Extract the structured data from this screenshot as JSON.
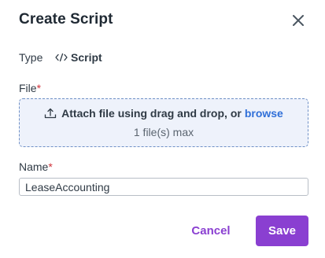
{
  "dialog": {
    "title": "Create Script",
    "close_icon": "close-icon"
  },
  "type": {
    "label": "Type",
    "value": "Script",
    "icon": "code-icon"
  },
  "file": {
    "label": "File",
    "required_marker": "*",
    "dropzone": {
      "icon": "upload-icon",
      "text": "Attach file using drag and drop, or",
      "browse_label": "browse",
      "max_text": "1 file(s) max"
    }
  },
  "name": {
    "label": "Name",
    "required_marker": "*",
    "value": "LeaseAccounting"
  },
  "actions": {
    "cancel_label": "Cancel",
    "save_label": "Save"
  },
  "colors": {
    "accent": "#8a3fd1",
    "link": "#2f6fd8",
    "required": "#d0323a",
    "dropzone_bg": "#eef2fb",
    "dropzone_border": "#6f90c6"
  }
}
